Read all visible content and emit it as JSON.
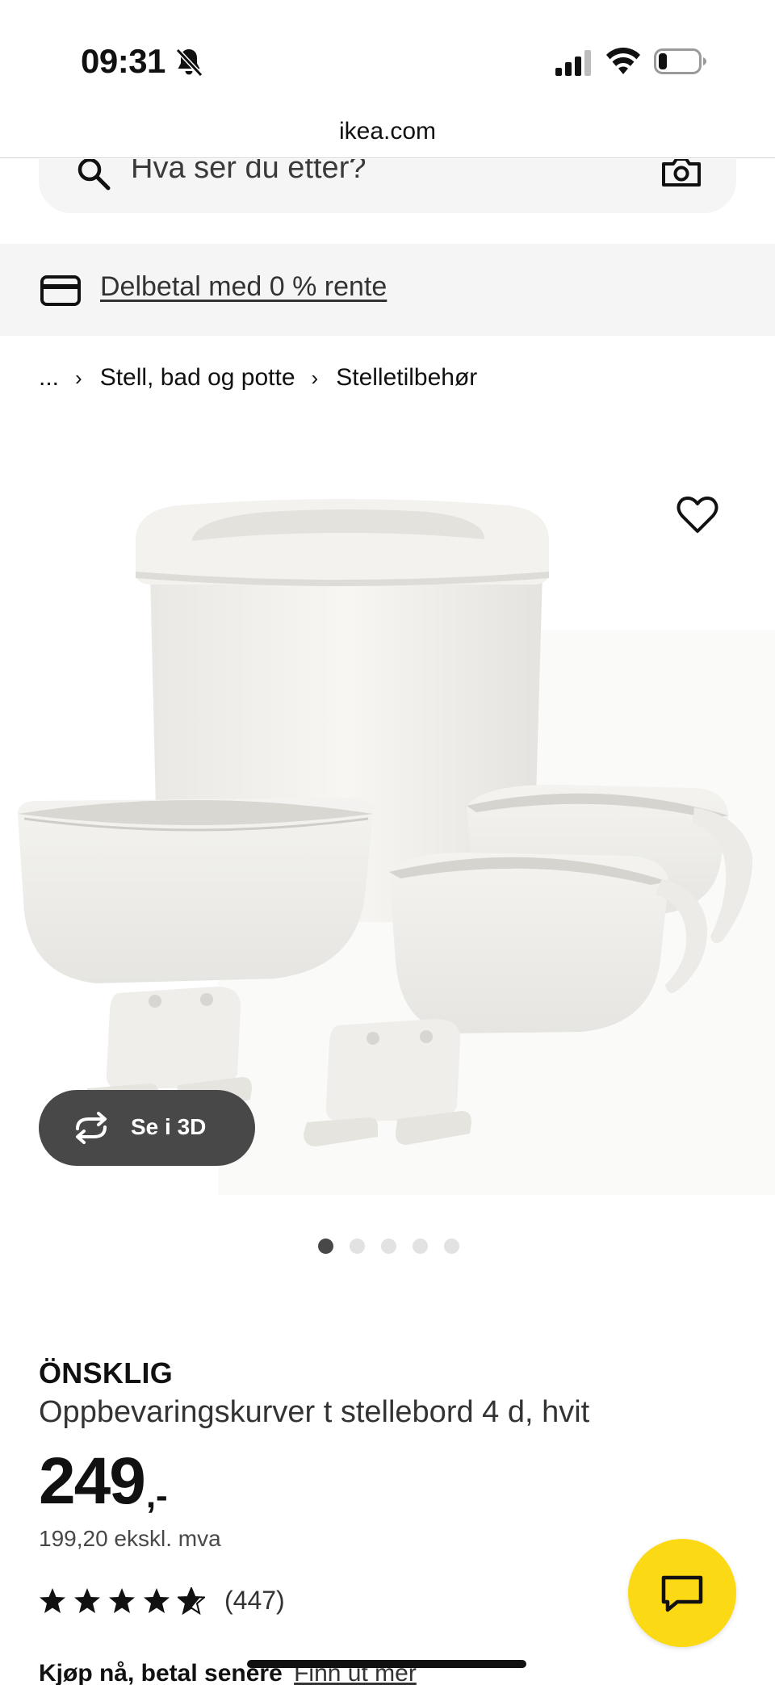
{
  "status_bar": {
    "time": "09:31",
    "icons": [
      "bell-slash-icon",
      "cellular-signal-icon",
      "wifi-icon",
      "battery-low-icon"
    ]
  },
  "browser": {
    "url": "ikea.com"
  },
  "search": {
    "placeholder": "Hva ser du etter?",
    "icons": [
      "search-icon",
      "camera-icon"
    ]
  },
  "promo": {
    "link_label": "Delbetal med 0 % rente",
    "icon": "credit-card-icon"
  },
  "breadcrumb": {
    "items": [
      "...",
      "Stell, bad og potte",
      "Stelletilbehør"
    ],
    "separator_icon": "chevron-right-icon"
  },
  "gallery": {
    "view_3d_label": "Se i 3D",
    "dot_count": 5,
    "active_dot": 1,
    "favorite_icon": "heart-outline-icon"
  },
  "product": {
    "brand": "ÖNSKLIG",
    "description": "Oppbevaringskurver t stellebord 4 d, hvit",
    "price_main": "249",
    "price_suffix": ",-",
    "price_ex_vat": "199,20 ekskl. mva",
    "rating_stars": 4.5,
    "rating_max": 5,
    "review_count": "(447)"
  },
  "bnpl": {
    "text": "Kjøp nå, betal senere",
    "link": "Finn ut mer"
  },
  "colors": {
    "ikea_yellow": "#FBD914",
    "dark_grey": "#484848",
    "light_grey_bg": "#F5F5F5"
  }
}
